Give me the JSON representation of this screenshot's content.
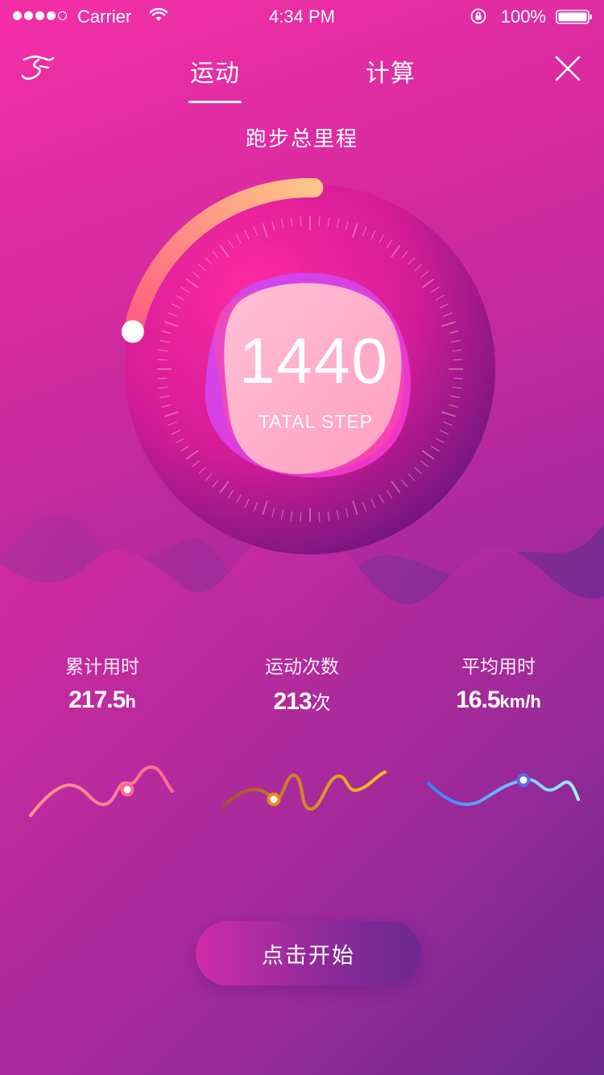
{
  "status_bar": {
    "carrier": "Carrier",
    "time": "4:34 PM",
    "battery": "100%"
  },
  "nav": {
    "tabs": [
      {
        "label": "运动",
        "active": true
      },
      {
        "label": "计算",
        "active": false
      }
    ]
  },
  "summary": {
    "title": "跑步总里程",
    "step_value": "1440",
    "step_label": "TATAL STEP",
    "progress": 0.22
  },
  "stats": [
    {
      "label": "累计用时",
      "value": "217.5",
      "unit": "h",
      "trend": [
        0.15,
        0.45,
        0.3,
        0.55,
        0.35,
        0.7
      ]
    },
    {
      "label": "运动次数",
      "value": "213",
      "unit": "次",
      "trend": [
        0.2,
        0.45,
        0.25,
        0.7,
        0.3,
        0.65
      ]
    },
    {
      "label": "平均用时",
      "value": "16.5",
      "unit": "km/h",
      "trend": [
        0.3,
        0.15,
        0.45,
        0.55,
        0.35,
        0.5
      ]
    }
  ],
  "colors": {
    "accent_pink": "#f42fa6",
    "accent_purple": "#3a2780",
    "arc_start": "#ff5a7e",
    "arc_end": "#ffc48a"
  },
  "action": {
    "start_label": "点击开始"
  },
  "icons": {
    "logo": "runner-icon",
    "close": "close-icon"
  }
}
